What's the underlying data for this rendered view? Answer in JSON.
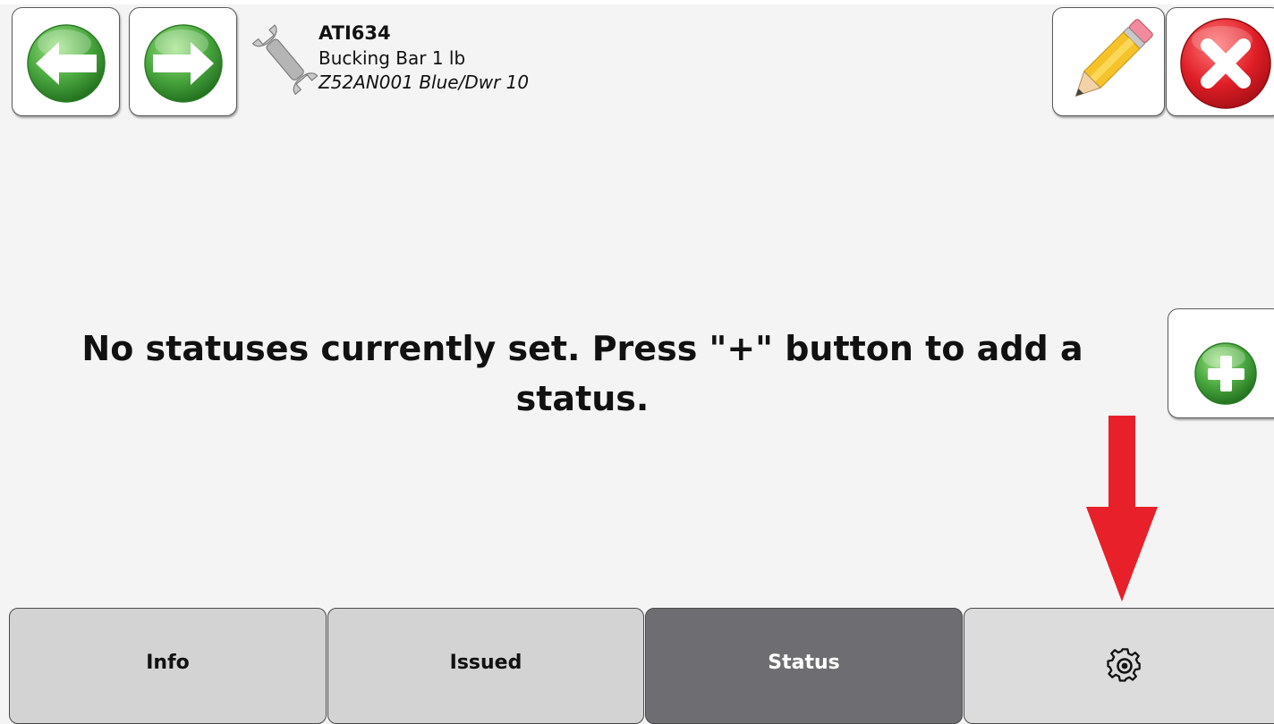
{
  "tool": {
    "id": "ATI634",
    "name": "Bucking Bar 1 lb",
    "location": "Z52AN001 Blue/Dwr 10"
  },
  "message": {
    "line1": "No statuses currently set.  Press \"+\" button to add a",
    "line2": "status."
  },
  "tabs": {
    "info": "Info",
    "issued": "Issued",
    "status": "Status",
    "settings_icon": "gear-icon"
  },
  "icons": {
    "back": "left-arrow-icon",
    "forward": "right-arrow-icon",
    "tool": "wrench-icon",
    "edit": "pencil-icon",
    "close": "close-icon",
    "add": "plus-icon",
    "annotation": "down-arrow-icon"
  },
  "colors": {
    "nav_green": "#3f9d3a",
    "close_red": "#e01e27",
    "annotation_red": "#e8202a",
    "active_tab": "#6e6e72",
    "inactive_tab": "#d3d3d3"
  }
}
